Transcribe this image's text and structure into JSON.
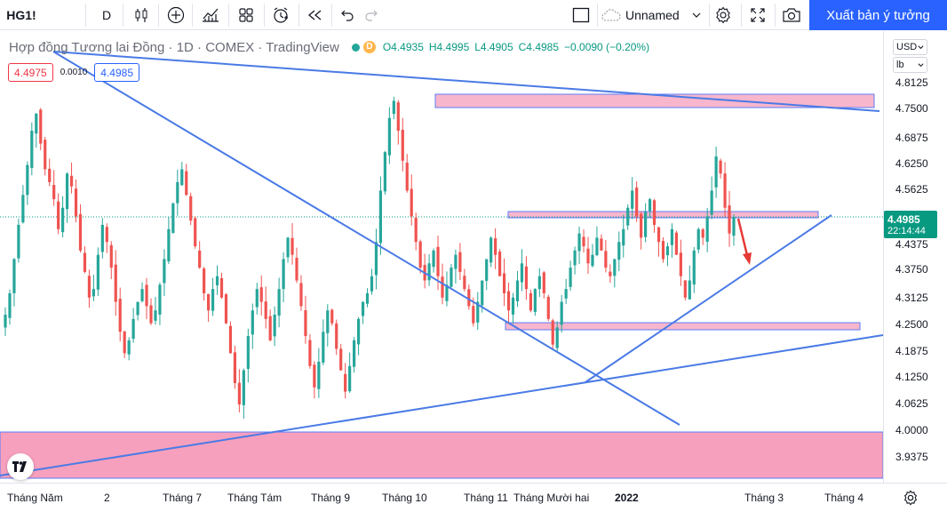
{
  "toolbar": {
    "symbol": "HG1!",
    "interval": "D",
    "layout_name": "Unnamed",
    "publish_label": "Xuất bản ý tưởng",
    "icons": [
      "candles-icon",
      "add-indicator-icon",
      "indicators-icon",
      "layout-grid-icon",
      "alert-icon",
      "replay-icon",
      "undo-icon",
      "redo-icon",
      "fullscreen-checkbox-icon",
      "cloud-icon",
      "settings-icon",
      "fullscreen-icon",
      "screenshot-icon"
    ]
  },
  "legend": {
    "title": "Hợp đồng Tương lai Đồng · 1D · COMEX · TradingView",
    "badge": "D",
    "open": "O4.4935",
    "high": "H4.4995",
    "low": "L4.4905",
    "close": "C4.4985",
    "change": "−0.0090 (−0.20%)"
  },
  "quote": {
    "bid": "4.4975",
    "spread": "0.0010",
    "ask": "4.4985"
  },
  "price_scale": {
    "currency": "USD",
    "unit": "lb",
    "ticks": [
      "4.8125",
      "4.7500",
      "4.6875",
      "4.6250",
      "4.5625",
      "4.5000",
      "4.4375",
      "4.3750",
      "4.3125",
      "4.2500",
      "4.1875",
      "4.1250",
      "4.0625",
      "4.0000",
      "3.9375"
    ],
    "last_price": "4.4985",
    "countdown": "22:14:44"
  },
  "time_scale": {
    "labels": [
      "Tháng Năm",
      "2",
      "Tháng 7",
      "Tháng Tám",
      "Tháng 9",
      "Tháng 10",
      "Tháng 11",
      "Tháng Mười hai",
      "2022",
      "Tháng 3",
      "Tháng 4"
    ]
  },
  "colors": {
    "up": "#26a69a",
    "down": "#ef5350",
    "trendline": "#2962ff",
    "zone_fill": "#f48fb1",
    "zone_border": "#5b7cf7",
    "arrow": "#e53935",
    "accent": "#2962ff"
  },
  "chart_data": {
    "type": "candlestick",
    "symbol": "HG1!",
    "timeframe": "1D",
    "price_range": [
      3.91,
      4.85
    ],
    "last_price": 4.4985,
    "closes": [
      4.27,
      4.32,
      4.4,
      4.48,
      4.55,
      4.62,
      4.7,
      4.74,
      4.67,
      4.61,
      4.58,
      4.54,
      4.47,
      4.52,
      4.6,
      4.57,
      4.5,
      4.42,
      4.37,
      4.31,
      4.33,
      4.41,
      4.48,
      4.44,
      4.38,
      4.3,
      4.23,
      4.18,
      4.21,
      4.26,
      4.3,
      4.33,
      4.29,
      4.25,
      4.28,
      4.34,
      4.4,
      4.47,
      4.53,
      4.58,
      4.61,
      4.55,
      4.49,
      4.43,
      4.38,
      4.32,
      4.28,
      4.33,
      4.36,
      4.31,
      4.25,
      4.18,
      4.11,
      4.06,
      4.14,
      4.22,
      4.28,
      4.33,
      4.3,
      4.26,
      4.21,
      4.27,
      4.33,
      4.4,
      4.45,
      4.41,
      4.35,
      4.29,
      4.22,
      4.15,
      4.1,
      4.16,
      4.23,
      4.28,
      4.25,
      4.19,
      4.14,
      4.09,
      4.15,
      4.21,
      4.26,
      4.3,
      4.32,
      4.36,
      4.44,
      4.56,
      4.65,
      4.73,
      4.77,
      4.7,
      4.63,
      4.56,
      4.5,
      4.44,
      4.38,
      4.35,
      4.39,
      4.42,
      4.36,
      4.31,
      4.34,
      4.38,
      4.41,
      4.37,
      4.33,
      4.29,
      4.25,
      4.3,
      4.35,
      4.4,
      4.45,
      4.41,
      4.36,
      4.32,
      4.28,
      4.31,
      4.35,
      4.39,
      4.33,
      4.28,
      4.33,
      4.36,
      4.32,
      4.26,
      4.2,
      4.24,
      4.3,
      4.33,
      4.38,
      4.42,
      4.46,
      4.43,
      4.39,
      4.41,
      4.45,
      4.42,
      4.38,
      4.36,
      4.4,
      4.44,
      4.47,
      4.52,
      4.56,
      4.5,
      4.45,
      4.51,
      4.54,
      4.48,
      4.44,
      4.4,
      4.43,
      4.47,
      4.41,
      4.36,
      4.31,
      4.35,
      4.42,
      4.47,
      4.45,
      4.5,
      4.56,
      4.64,
      4.6,
      4.52,
      4.46,
      4.4985
    ]
  },
  "drawings": {
    "trendlines": 5,
    "zones": 4,
    "arrow": "down"
  }
}
